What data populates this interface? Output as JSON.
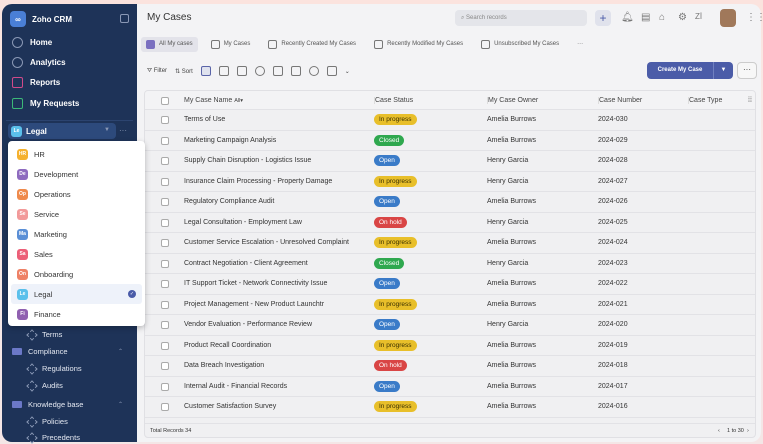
{
  "app": {
    "name": "Zoho CRM",
    "logo_text": "∞"
  },
  "nav": [
    {
      "label": "Home"
    },
    {
      "label": "Analytics"
    },
    {
      "label": "Reports"
    },
    {
      "label": "My Requests"
    }
  ],
  "workspace": {
    "current": "Legal",
    "abbr": "Le",
    "color": "#5bc0eb",
    "more": "···"
  },
  "workspace_menu": [
    {
      "abbr": "HR",
      "label": "HR",
      "color": "#f5b12e"
    },
    {
      "abbr": "De",
      "label": "Development",
      "color": "#8e6bbf"
    },
    {
      "abbr": "Op",
      "label": "Operations",
      "color": "#ef8a4c"
    },
    {
      "abbr": "Se",
      "label": "Service",
      "color": "#f29a9a"
    },
    {
      "abbr": "Ma",
      "label": "Marketing",
      "color": "#5b8fd6"
    },
    {
      "abbr": "Sa",
      "label": "Sales",
      "color": "#ec5f78"
    },
    {
      "abbr": "On",
      "label": "Onboarding",
      "color": "#ee8166"
    },
    {
      "abbr": "Le",
      "label": "Legal",
      "color": "#5bc0eb",
      "selected": true
    },
    {
      "abbr": "Fi",
      "label": "Finance",
      "color": "#9060b0"
    }
  ],
  "tree": [
    {
      "label": "Terms",
      "type": "item"
    },
    {
      "label": "Compliance",
      "type": "folder"
    },
    {
      "label": "Regulations",
      "type": "item"
    },
    {
      "label": "Audits",
      "type": "item"
    },
    {
      "label": "Knowledge base",
      "type": "folder"
    },
    {
      "label": "Policies",
      "type": "item"
    },
    {
      "label": "Precedents",
      "type": "item"
    }
  ],
  "header": {
    "title": "My Cases",
    "search_placeholder": "Search records",
    "plus": "+"
  },
  "tabs": [
    {
      "label": "All My cases",
      "active": true
    },
    {
      "label": "My Cases"
    },
    {
      "label": "Recently Created My Cases"
    },
    {
      "label": "Recently Modified My Cases"
    },
    {
      "label": "Unsubscribed My Cases"
    },
    {
      "label": "···"
    }
  ],
  "toolbar": {
    "filter": "Filter",
    "sort": "Sort",
    "create": "Create My Case",
    "more": "···"
  },
  "table": {
    "columns": {
      "name": "My Case Name",
      "filter": "All▾",
      "status": "Case Status",
      "owner": "My Case Owner",
      "number": "Case Number",
      "type": "Case Type"
    },
    "rows": [
      {
        "name": "Terms of Use",
        "status": "In progress",
        "owner": "Amelia Burrows",
        "number": "2024-030"
      },
      {
        "name": "Marketing Campaign Analysis",
        "status": "Closed",
        "owner": "Amelia Burrows",
        "number": "2024-029"
      },
      {
        "name": "Supply Chain Disruption - Logistics Issue",
        "status": "Open",
        "owner": "Henry Garcia",
        "number": "2024-028"
      },
      {
        "name": "Insurance Claim Processing - Property Damage",
        "status": "In progress",
        "owner": "Henry Garcia",
        "number": "2024-027"
      },
      {
        "name": "Regulatory Compliance Audit",
        "status": "Open",
        "owner": "Amelia Burrows",
        "number": "2024-026"
      },
      {
        "name": "Legal Consultation - Employment Law",
        "status": "On hold",
        "owner": "Henry Garcia",
        "number": "2024-025"
      },
      {
        "name": "Customer Service Escalation - Unresolved Complaint",
        "status": "In progress",
        "owner": "Amelia Burrows",
        "number": "2024-024"
      },
      {
        "name": "Contract Negotiation - Client Agreement",
        "status": "Closed",
        "owner": "Henry Garcia",
        "number": "2024-023"
      },
      {
        "name": "IT Support Ticket - Network Connectivity Issue",
        "status": "Open",
        "owner": "Amelia Burrows",
        "number": "2024-022"
      },
      {
        "name": "Project Management - New Product Launchtr",
        "status": "In progress",
        "owner": "Amelia Burrows",
        "number": "2024-021"
      },
      {
        "name": "Vendor Evaluation - Performance Review",
        "status": "Open",
        "owner": "Henry Garcia",
        "number": "2024-020"
      },
      {
        "name": "Product Recall Coordination",
        "status": "In progress",
        "owner": "Amelia Burrows",
        "number": "2024-019"
      },
      {
        "name": "Data Breach Investigation",
        "status": "On hold",
        "owner": "Amelia Burrows",
        "number": "2024-018"
      },
      {
        "name": "Internal Audit - Financial Records",
        "status": "Open",
        "owner": "Amelia Burrows",
        "number": "2024-017"
      },
      {
        "name": "Customer Satisfaction Survey",
        "status": "In progress",
        "owner": "Amelia Burrows",
        "number": "2024-016"
      }
    ],
    "total": "Total Records 34",
    "pagination": "1 to 30"
  }
}
